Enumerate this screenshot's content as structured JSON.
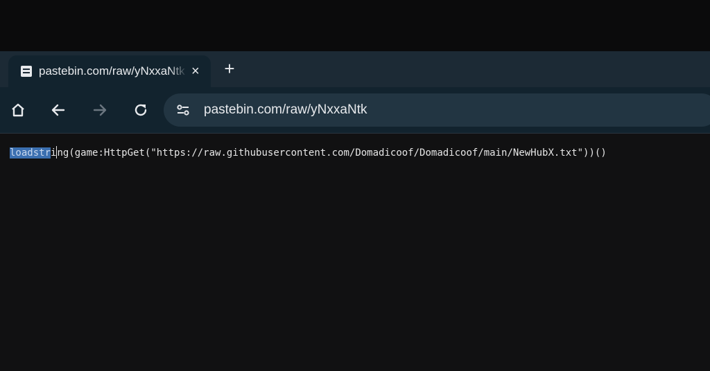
{
  "browser": {
    "tab": {
      "title": "pastebin.com/raw/yNxxaNtk",
      "close_glyph": "×",
      "favicon_icon": "pastebin-favicon-icon"
    },
    "new_tab_glyph": "+",
    "toolbar": {
      "home_icon": "home-icon",
      "back_icon": "back-arrow-icon",
      "forward_icon": "forward-arrow-icon",
      "reload_icon": "reload-icon",
      "site_info_icon": "site-settings-icon"
    },
    "address_bar": {
      "url": "pastebin.com/raw/yNxxaNtk"
    }
  },
  "page": {
    "code": {
      "selected_text": "loadstr",
      "rest_before_caret": "i",
      "rest_after_caret": "ng(game:HttpGet(\"https://raw.githubusercontent.com/Domadicoof/Domadicoof/main/NewHubX.txt\"))()"
    }
  },
  "colors": {
    "tabstrip": "#1c2a35",
    "toolbar": "#12232e",
    "omnibox": "#223542",
    "content_bg": "#111112",
    "selection": "#3b6fb0"
  }
}
